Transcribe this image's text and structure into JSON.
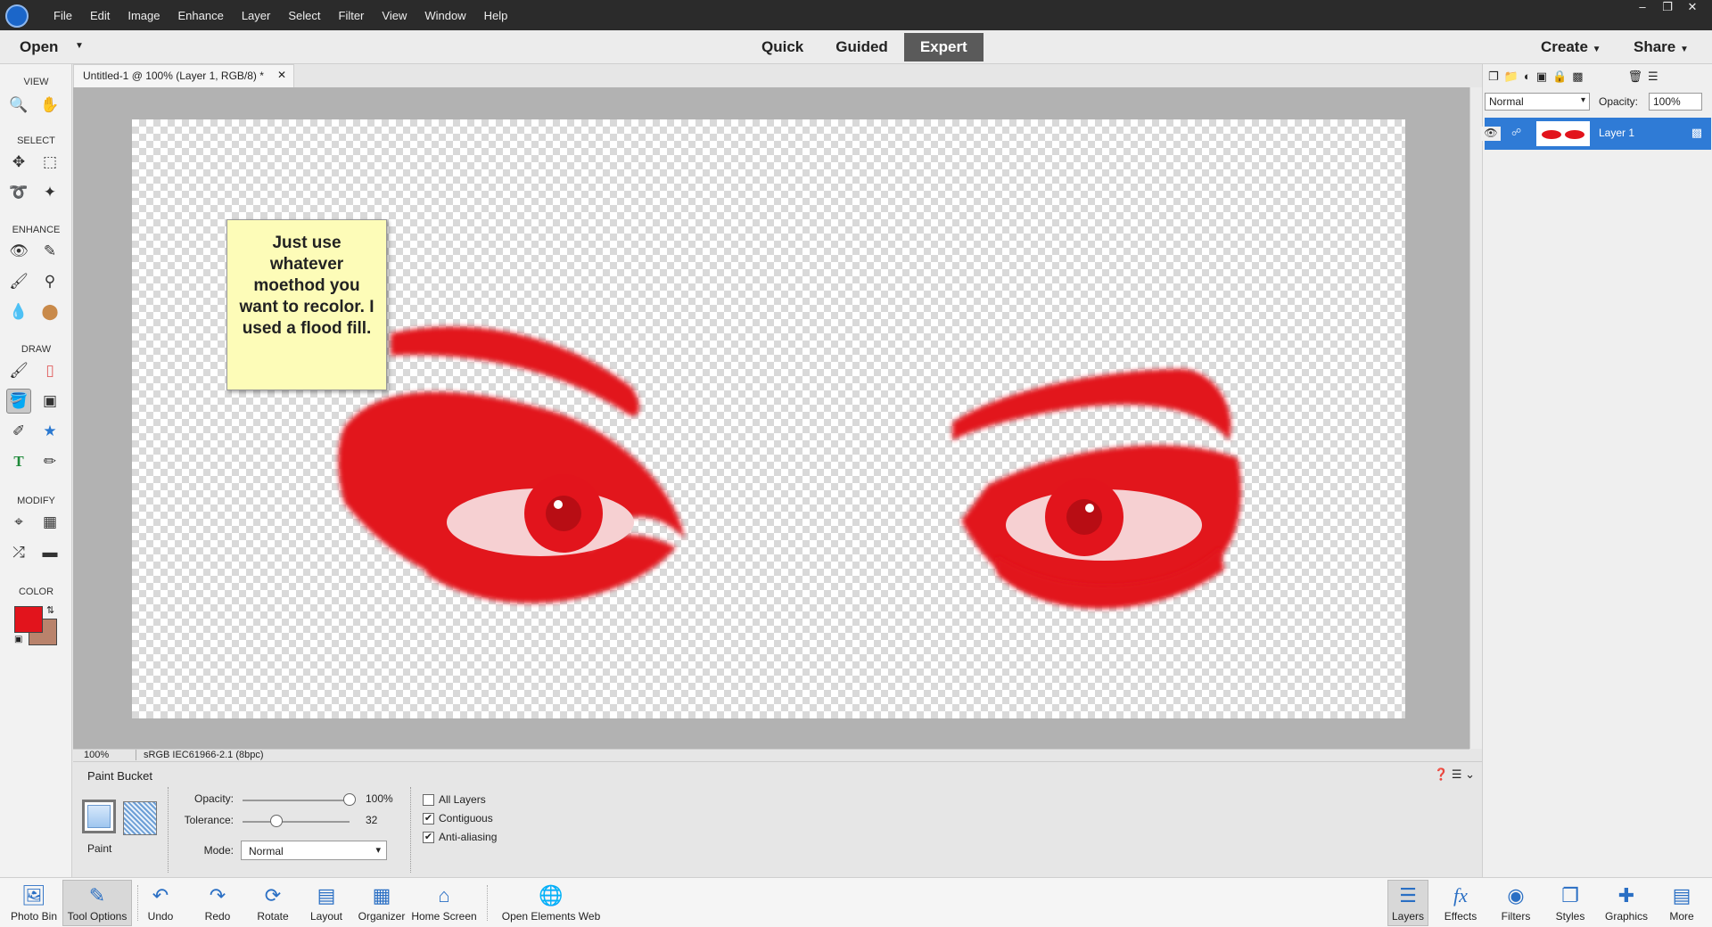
{
  "menubar": {
    "items": [
      "File",
      "Edit",
      "Image",
      "Enhance",
      "Layer",
      "Select",
      "Filter",
      "View",
      "Window",
      "Help"
    ]
  },
  "modebar": {
    "open_label": "Open",
    "modes": [
      "Quick",
      "Guided",
      "Expert"
    ],
    "active_mode": "Expert",
    "create_label": "Create",
    "share_label": "Share"
  },
  "toolbox": {
    "sections": {
      "view": "VIEW",
      "select": "SELECT",
      "enhance": "ENHANCE",
      "draw": "DRAW",
      "modify": "MODIFY",
      "color": "COLOR"
    },
    "active_tool": "paint-bucket-tool",
    "foreground_color": "#e2141c",
    "background_color": "#b9836c"
  },
  "document": {
    "tab_title": "Untitled-1 @ 100% (Layer 1, RGB/8) *",
    "zoom": "100%",
    "color_profile": "sRGB IEC61966-2.1 (8bpc)"
  },
  "note": {
    "text": "Just use whatever moethod you want to recolor.   I used a flood fill."
  },
  "layers_panel": {
    "blend_mode": "Normal",
    "opacity_label": "Opacity:",
    "opacity_value": "100%",
    "layers": [
      {
        "name": "Layer 1",
        "visible": true,
        "selected": true
      }
    ]
  },
  "tool_options": {
    "tool_name": "Paint Bucket",
    "fill_type_label": "Paint",
    "opacity_label": "Opacity:",
    "opacity_value": "100%",
    "opacity_fraction": 1.0,
    "tolerance_label": "Tolerance:",
    "tolerance_value": "32",
    "tolerance_fraction": 0.32,
    "mode_label": "Mode:",
    "mode_value": "Normal",
    "checkboxes": [
      {
        "label": "All Layers",
        "checked": false
      },
      {
        "label": "Contiguous",
        "checked": true
      },
      {
        "label": "Anti-aliasing",
        "checked": true
      }
    ]
  },
  "taskbar": {
    "left": [
      "Photo Bin",
      "Tool Options",
      "Undo",
      "Redo",
      "Rotate",
      "Layout",
      "Organizer",
      "Home Screen",
      "Open Elements Web"
    ],
    "right": [
      "Layers",
      "Effects",
      "Filters",
      "Styles",
      "Graphics",
      "More"
    ]
  },
  "colors": {
    "accent": "#2f7bd6",
    "eye_red": "#e2141c"
  }
}
